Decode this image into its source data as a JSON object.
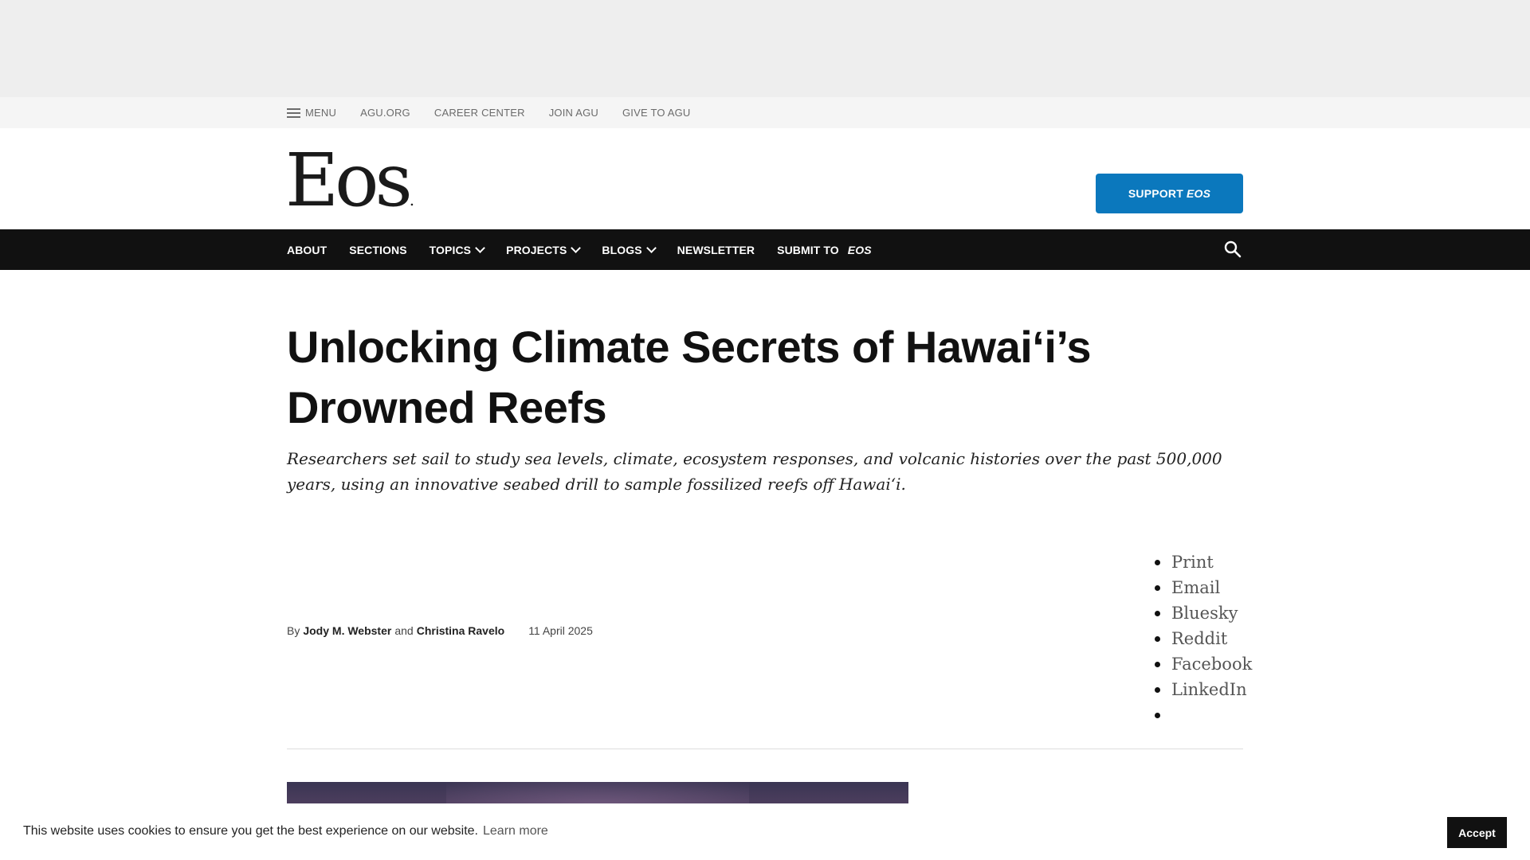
{
  "utility": {
    "menu_label": "MENU",
    "links": [
      "AGU.ORG",
      "CAREER CENTER",
      "JOIN AGU",
      "GIVE TO AGU"
    ]
  },
  "masthead": {
    "logo_text": "Eos",
    "logo_mark": ".",
    "support_label": "SUPPORT",
    "support_em": "EOS"
  },
  "nav": {
    "about": "ABOUT",
    "sections": "SECTIONS",
    "topics": "TOPICS",
    "projects": "PROJECTS",
    "blogs": "BLOGS",
    "newsletter": "NEWSLETTER",
    "submit": "SUBMIT TO",
    "submit_em": "EOS"
  },
  "article": {
    "title": "Unlocking Climate Secrets of Hawai‘i’s Drowned Reefs",
    "dek": "Researchers set sail to study sea levels, climate, ecosystem responses, and volcanic histories over the past 500,000 years, using an innovative seabed drill to sample fossilized reefs off Hawai‘i.",
    "by": "By",
    "author1": "Jody M. Webster",
    "and": "and",
    "author2": "Christina Ravelo",
    "date": "11 April 2025"
  },
  "share": {
    "items": [
      "Print",
      "Email",
      "Bluesky",
      "Reddit",
      "Facebook",
      "LinkedIn",
      ""
    ]
  },
  "cookie": {
    "message": "This website uses cookies to ensure you get the best experience on our website.",
    "learn_more": "Learn more",
    "accept": "Accept"
  },
  "icons": {
    "menu": "hamburger-icon",
    "search": "search-icon",
    "dropdown": "chevron-down-icon"
  },
  "colors": {
    "support_button": "#0b78bd",
    "nav_background": "#111111",
    "ad_band": "#eeeeee"
  }
}
